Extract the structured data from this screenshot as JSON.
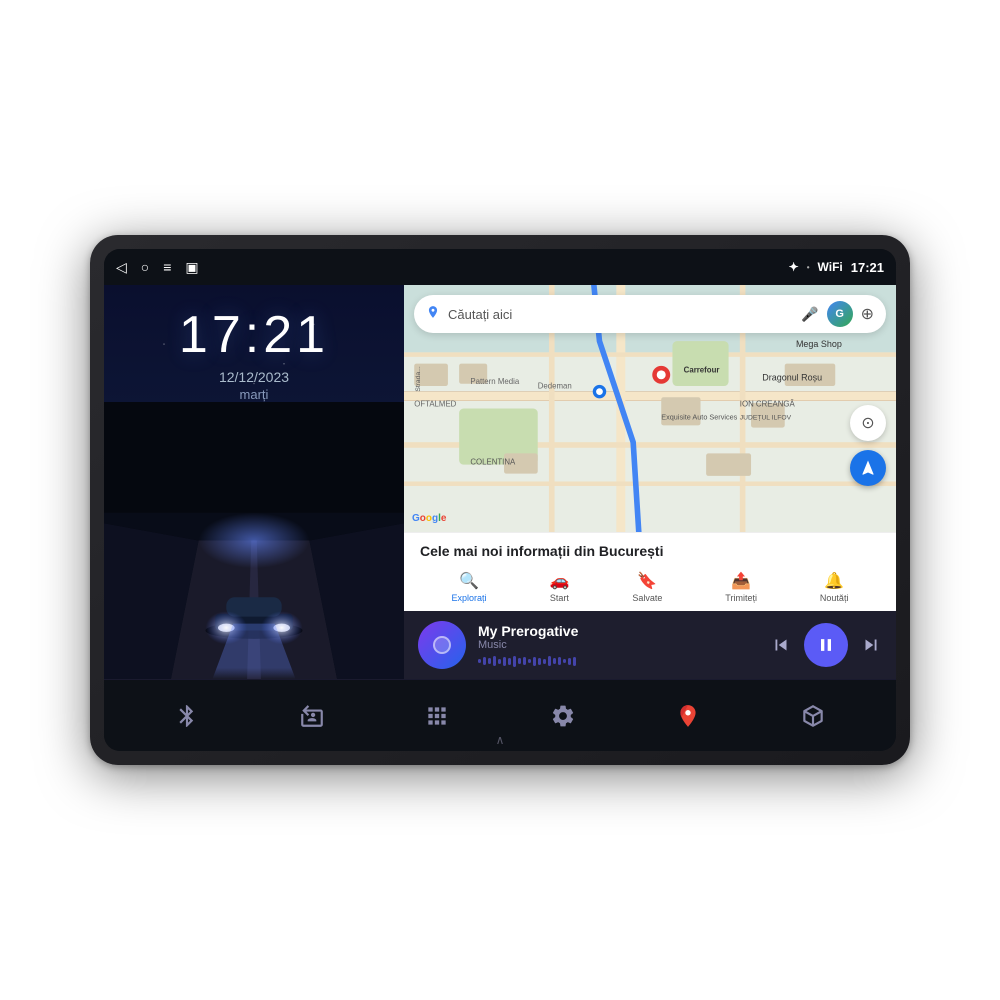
{
  "device": {
    "status_bar": {
      "nav_back": "◁",
      "nav_home": "○",
      "nav_menu": "≡",
      "nav_screenshot": "▣",
      "bluetooth_icon": "⚡",
      "wifi_icon": "WiFi",
      "time": "17:21"
    },
    "left_panel": {
      "clock_time": "17:21",
      "clock_date": "12/12/2023",
      "clock_day": "marți"
    },
    "right_panel": {
      "map": {
        "search_placeholder": "Căutați aici",
        "info_title": "Cele mai noi informații din București",
        "tabs": [
          {
            "label": "Explorați",
            "icon": "🔍"
          },
          {
            "label": "Start",
            "icon": "🚗"
          },
          {
            "label": "Salvate",
            "icon": "🔖"
          },
          {
            "label": "Trimiteți",
            "icon": "📤"
          },
          {
            "label": "Noutăți",
            "icon": "🔔"
          }
        ],
        "google_logo": "Google"
      },
      "music": {
        "title": "My Prerogative",
        "source": "Music",
        "album_art": "music-note"
      }
    },
    "bottom_nav": {
      "items": [
        {
          "icon": "bluetooth",
          "label": "Bluetooth"
        },
        {
          "icon": "radio",
          "label": "Radio"
        },
        {
          "icon": "apps",
          "label": "Apps"
        },
        {
          "icon": "settings",
          "label": "Settings"
        },
        {
          "icon": "maps",
          "label": "Maps"
        },
        {
          "icon": "3d-box",
          "label": "3D"
        }
      ]
    }
  }
}
